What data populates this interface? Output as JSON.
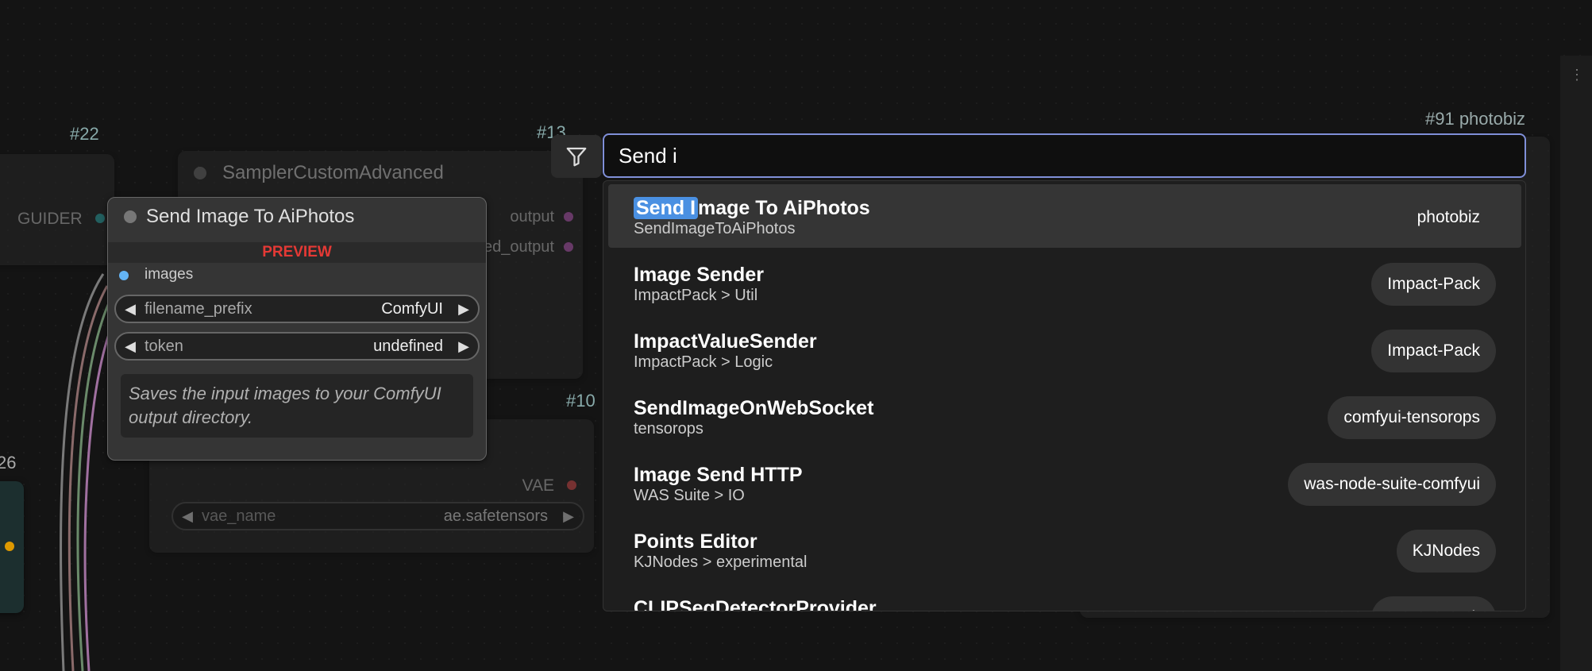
{
  "canvas": {
    "node_22": {
      "id_label": "#22",
      "output_label": "GUIDER"
    },
    "node_13": {
      "id_label": "#13",
      "title": "SamplerCustomAdvanced",
      "outputs": [
        "output",
        "denoised_output"
      ]
    },
    "node_10": {
      "id_label": "#10",
      "output_label": "VAE",
      "widget": {
        "name": "vae_name",
        "value": "ae.safetensors"
      }
    },
    "node_26": {
      "id_label": "26"
    },
    "node_91": {
      "id_label": "#91 photobiz"
    }
  },
  "preview_node": {
    "title": "Send Image To AiPhotos",
    "badge": "PREVIEW",
    "input_label": "images",
    "widgets": [
      {
        "name": "filename_prefix",
        "value": "ComfyUI"
      },
      {
        "name": "token",
        "value": "undefined"
      }
    ],
    "description": "Saves the input images to your ComfyUI output directory.",
    "colors": {
      "badge": "#e53935",
      "images_slot": "#64b5f6"
    }
  },
  "search": {
    "query": "Send i",
    "filter_icon": "filter-icon",
    "results": [
      {
        "title_highlight": "Send I",
        "title_rest": "mage To AiPhotos",
        "subtitle": "SendImageToAiPhotos",
        "badge": "photobiz",
        "selected": true
      },
      {
        "title_highlight": "",
        "title_rest": "Image Sender",
        "subtitle": "ImpactPack > Util",
        "badge": "Impact-Pack",
        "selected": false
      },
      {
        "title_highlight": "",
        "title_rest": "ImpactValueSender",
        "subtitle": "ImpactPack > Logic",
        "badge": "Impact-Pack",
        "selected": false
      },
      {
        "title_highlight": "",
        "title_rest": "SendImageOnWebSocket",
        "subtitle": "tensorops",
        "badge": "comfyui-tensorops",
        "selected": false
      },
      {
        "title_highlight": "",
        "title_rest": "Image Send HTTP",
        "subtitle": "WAS Suite > IO",
        "badge": "was-node-suite-comfyui",
        "selected": false
      },
      {
        "title_highlight": "",
        "title_rest": "Points Editor",
        "subtitle": "KJNodes > experimental",
        "badge": "KJNodes",
        "selected": false
      },
      {
        "title_highlight": "",
        "title_rest": "CLIPSegDetectorProvider",
        "subtitle": "",
        "badge": "Impact-Pack",
        "selected": false
      }
    ]
  },
  "colors": {
    "accent_border": "#7f8fd8",
    "highlight": "#4a90e2"
  }
}
